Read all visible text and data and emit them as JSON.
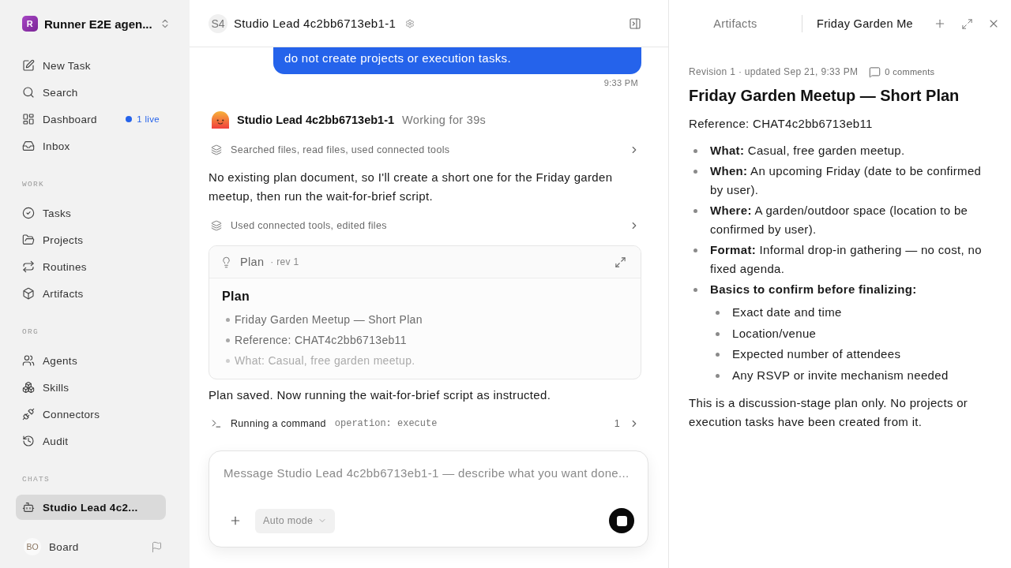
{
  "sidebar": {
    "workspace": {
      "initial": "R",
      "name": "Runner E2E agen..."
    },
    "sections": [
      {
        "items": [
          {
            "label": "New Task",
            "selected": false
          },
          {
            "label": "Search",
            "selected": false
          },
          {
            "label": "Dashboard",
            "selected": false,
            "badge": "1 live"
          },
          {
            "label": "Inbox",
            "selected": false
          }
        ]
      },
      {
        "title": "WORK",
        "items": [
          {
            "label": "Tasks",
            "selected": false
          },
          {
            "label": "Projects",
            "selected": false
          },
          {
            "label": "Routines",
            "selected": false
          },
          {
            "label": "Artifacts",
            "selected": false
          }
        ]
      },
      {
        "title": "ORG",
        "items": [
          {
            "label": "Agents",
            "selected": false
          },
          {
            "label": "Skills",
            "selected": false
          },
          {
            "label": "Connectors",
            "selected": false
          },
          {
            "label": "Audit",
            "selected": false
          }
        ]
      },
      {
        "title": "CHATS",
        "items": [
          {
            "label": "Studio Lead 4c2...",
            "selected": true
          }
        ]
      }
    ],
    "user": {
      "initials": "BO",
      "name": "Board"
    }
  },
  "chat": {
    "header": {
      "avatar": "S4",
      "title": "Studio Lead 4c2bb6713eb1-1"
    },
    "user_message": {
      "text": "do not create projects or execution tasks.",
      "time": "9:33 PM"
    },
    "agent": {
      "name": "Studio Lead 4c2bb6713eb1-1",
      "status": "Working for 39s"
    },
    "stream": [
      {
        "kind": "activity",
        "text": "Searched files, read files, used connected tools"
      },
      {
        "kind": "text",
        "text": "No existing plan document, so I'll create a short one for the Friday garden meetup, then run the wait-for-brief script."
      },
      {
        "kind": "activity",
        "text": "Used connected tools, edited files"
      },
      {
        "kind": "artifact",
        "label": "Plan",
        "revision": "· rev 1",
        "heading": "Plan",
        "items": [
          "Friday Garden Meetup — Short Plan",
          "Reference: CHAT4c2bb6713eb11",
          "What: Casual, free garden meetup."
        ]
      },
      {
        "kind": "text",
        "text": "Plan saved. Now running the wait-for-brief script as instructed."
      },
      {
        "kind": "command",
        "label": "Running a command",
        "detail": "operation: execute",
        "count": "1"
      }
    ],
    "composer": {
      "placeholder": "Message Studio Lead 4c2bb6713eb1-1 — describe what you want done...",
      "mode": "Auto mode"
    }
  },
  "artifact_panel": {
    "tabs": [
      {
        "label": "Artifacts",
        "selected": false
      },
      {
        "label": "Friday Garden Me",
        "selected": true
      }
    ],
    "revision": "Revision 1 · updated Sep 21, 9:33 PM",
    "comments": "0 comments",
    "title": "Friday Garden Meetup — Short Plan",
    "reference": "Reference: CHAT4c2bb6713eb11",
    "items": [
      {
        "label": "What:",
        "text": "Casual, free garden meetup."
      },
      {
        "label": "When:",
        "text": "An upcoming Friday (date to be confirmed by user)."
      },
      {
        "label": "Where:",
        "text": "A garden/outdoor space (location to be confirmed by user)."
      },
      {
        "label": "Format:",
        "text": "Informal drop-in gathering — no cost, no fixed agenda."
      },
      {
        "label": "Basics to confirm before finalizing:",
        "children": [
          {
            "text": "Exact date and time"
          },
          {
            "text": "Location/venue"
          },
          {
            "text": "Expected number of attendees"
          },
          {
            "text": "Any RSVP or invite mechanism needed"
          }
        ]
      }
    ],
    "note": "This is a discussion-stage plan only. No projects or execution tasks have been created from it."
  }
}
